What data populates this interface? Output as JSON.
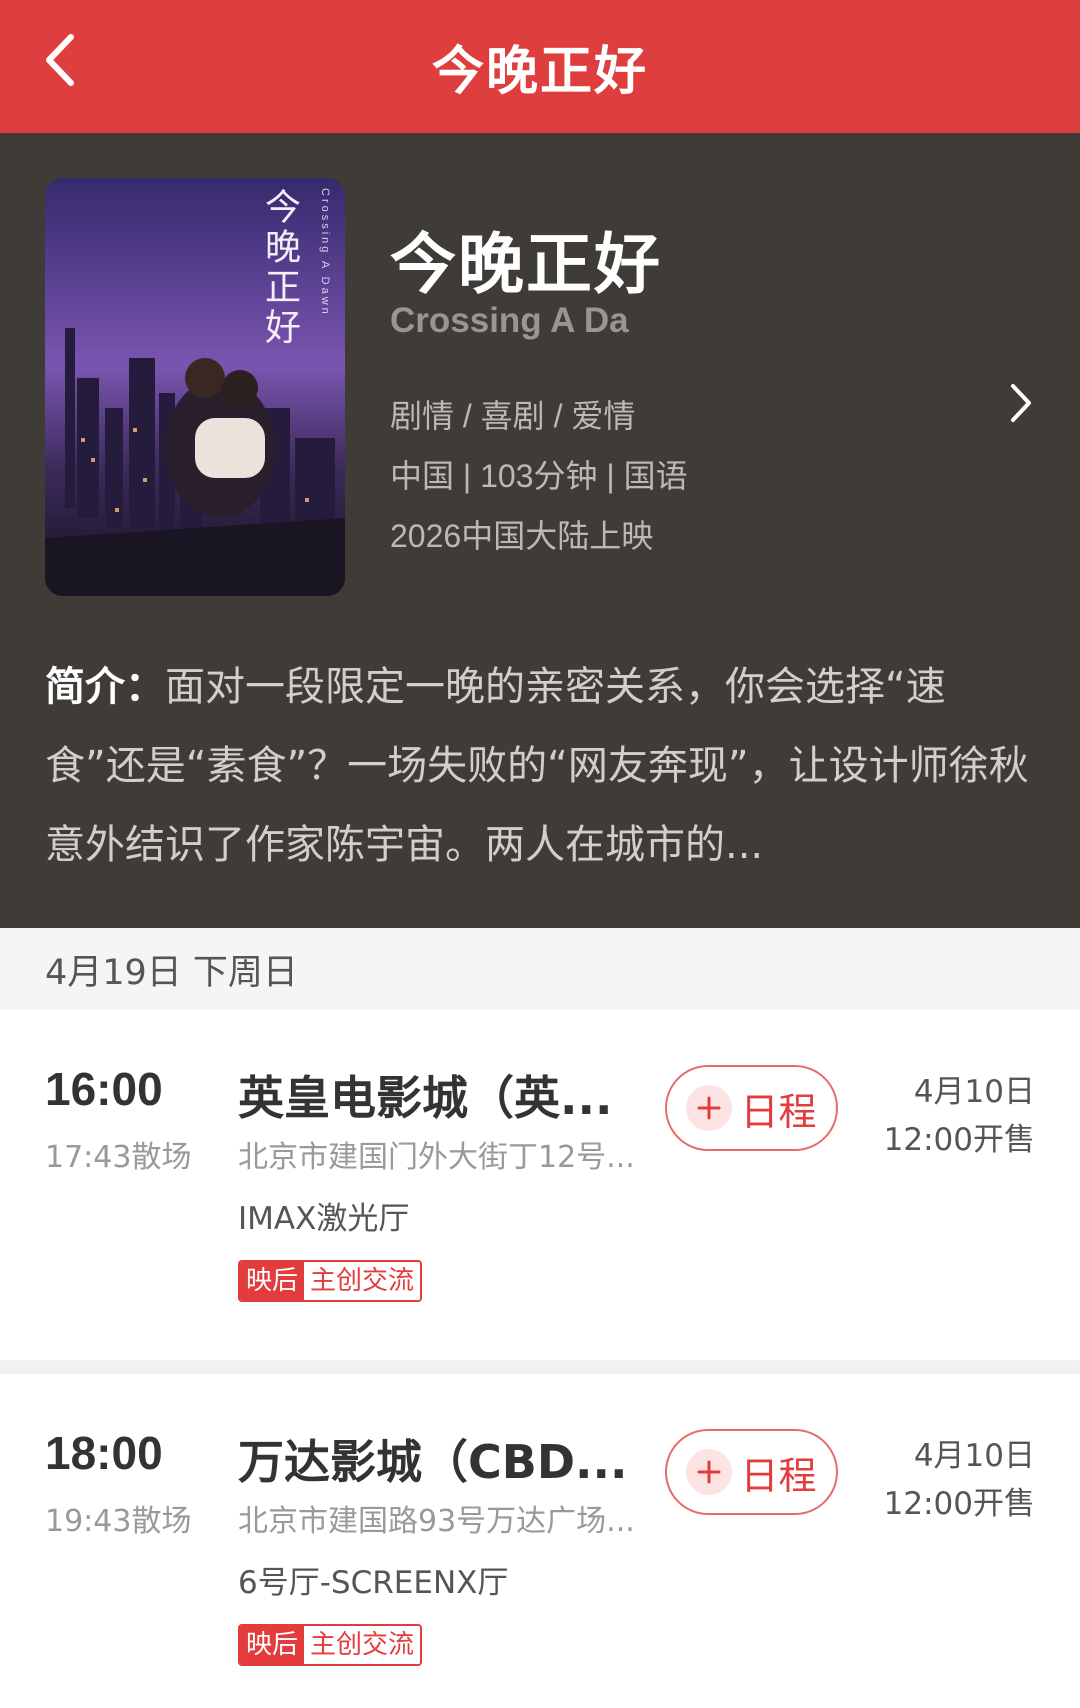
{
  "header": {
    "title": "今晚正好",
    "back_icon": "chevron-left-icon"
  },
  "movie": {
    "poster_title_art": "今晚正好",
    "poster_sub_art": "Crossing A Dawn",
    "title_cn": "今晚正好",
    "title_en": "Crossing A Da",
    "genres": "剧情 / 喜剧 / 爱情",
    "info": "中国 | 103分钟 | 国语",
    "release": "2026中国大陆上映",
    "synopsis_label": "简介：",
    "synopsis_text": "面对一段限定一晚的亲密关系，你会选择“速食”还是“素食”？一场失败的“网友奔现”，让设计师徐秋意外结识了作家陈宇宙。两人在城市的..."
  },
  "date_bar": {
    "label": "4月19日 下周日"
  },
  "showtimes": [
    {
      "start": "16:00",
      "end": "17:43散场",
      "cinema": "英皇电影城（英...",
      "address": "北京市建国门外大街丁12号...",
      "hall": "IMAX激光厅",
      "tag_left": "映后",
      "tag_right": "主创交流",
      "schedule_label": "日程",
      "sale_date": "4月10日",
      "sale_time": "12:00开售"
    },
    {
      "start": "18:00",
      "end": "19:43散场",
      "cinema": "万达影城（CBD...",
      "address": "北京市建国路93号万达广场...",
      "hall": "6号厅-SCREENX厅",
      "tag_left": "映后",
      "tag_right": "主创交流",
      "schedule_label": "日程",
      "sale_date": "4月10日",
      "sale_time": "12:00开售"
    }
  ],
  "colors": {
    "brand": "#de3f3e",
    "hero_bg": "#3f3b36",
    "accent": "#e23c3c"
  }
}
